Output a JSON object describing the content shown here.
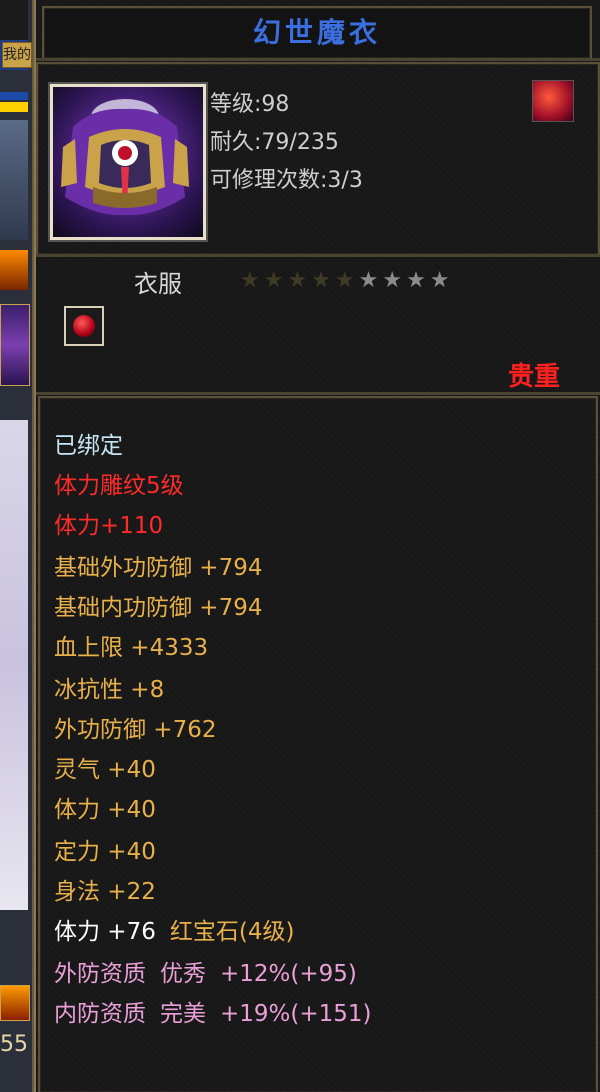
{
  "side": {
    "tab_label": "我的",
    "number": "55"
  },
  "item": {
    "name": "幻世魔衣",
    "level": "等级:98",
    "durability": "耐久:79/235",
    "repairs": "可修理次数:3/3",
    "type": "衣服",
    "stars_dim": "★★★★★",
    "stars_grey": "★★★★",
    "rarity": "贵重"
  },
  "attrs": {
    "bound": "已绑定",
    "carve": "体力雕纹5级",
    "carve_bonus": "体力+110",
    "base_outer_def": "基础外功防御 +794",
    "base_inner_def": "基础内功防御 +794",
    "hp": "血上限 +4333",
    "ice_res": "冰抗性 +8",
    "outer_def": "外功防御 +762",
    "spirit": "灵气 +40",
    "stamina": "体力 +40",
    "focus": "定力 +40",
    "agility": "身法 +22",
    "gem_stat": "体力 +76",
    "gem_name": "红宝石(4级)",
    "outer_quality": "外防资质",
    "outer_quality_grade": "优秀",
    "outer_quality_value": "+12%(+95)",
    "inner_quality": "内防资质",
    "inner_quality_grade": "完美",
    "inner_quality_value": "+19%(+151)"
  },
  "colors": {
    "title": "#3b6fe0",
    "rarity": "#ff2020",
    "bound": "#c6e4f4",
    "carve": "#ff2a2a",
    "stat": "#e8b04a",
    "quality": "#e9a0d8"
  }
}
